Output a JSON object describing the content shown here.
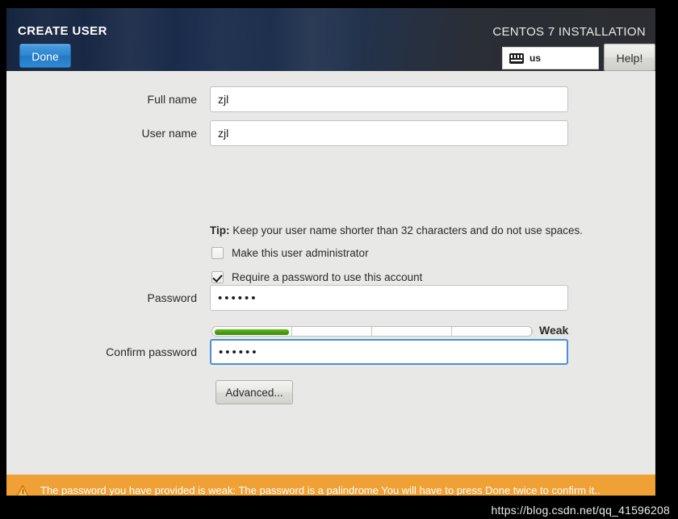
{
  "header": {
    "screen_title": "CREATE USER",
    "product_title": "CENTOS 7 INSTALLATION",
    "done_label": "Done",
    "help_label": "Help!",
    "keyboard_layout": "us",
    "keyboard_icon": "keyboard-icon",
    "accent_blue": "#2d84cf",
    "bar_dark": "#1b2c4c"
  },
  "form": {
    "full_name": {
      "label": "Full name",
      "value": "zjl",
      "placeholder": ""
    },
    "user_name": {
      "label": "User name",
      "value": "zjl",
      "placeholder": ""
    },
    "tip_prefix": "Tip:",
    "tip_text": " Keep your user name shorter than 32 characters and do not use spaces.",
    "make_admin": {
      "label": "Make this user administrator",
      "checked": false
    },
    "require_password": {
      "label": "Require a password to use this account",
      "checked": true
    },
    "password": {
      "label": "Password",
      "value": "••••••",
      "placeholder": ""
    },
    "confirm_password": {
      "label": "Confirm password",
      "value": "••••••",
      "placeholder": "",
      "focused": true
    },
    "strength": {
      "label": "Weak",
      "segments": 4,
      "filled_fraction": 0.235,
      "fill_color": "#4a9c10"
    },
    "advanced_label": "Advanced..."
  },
  "warning": {
    "icon": "warning-triangle-icon",
    "message": "The password you have provided is weak: The password is a palindrome You will have to press Done twice to confirm it..",
    "background": "#f0a135"
  },
  "watermark": {
    "text": "https://blog.csdn.net/qq_41596208"
  }
}
